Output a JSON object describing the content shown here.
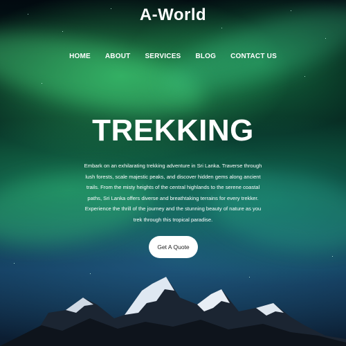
{
  "brand": {
    "logo": "A-World"
  },
  "nav": {
    "items": [
      {
        "label": "HOME"
      },
      {
        "label": "ABOUT"
      },
      {
        "label": "SERVICES"
      },
      {
        "label": "BLOG"
      },
      {
        "label": "CONTACT US"
      }
    ]
  },
  "hero": {
    "title": "TREKKING",
    "description": "Embark on an exhilarating trekking adventure in Sri Lanka. Traverse through lush forests, scale majestic peaks, and discover hidden gems along ancient trails. From the misty heights of the central highlands to the serene coastal paths, Sri Lanka offers diverse and breathtaking terrains for every trekker. Experience the thrill of the journey and the stunning beauty of nature as you trek through this tropical paradise.",
    "cta_label": "Get A Quote"
  },
  "colors": {
    "text": "#ffffff",
    "button_bg": "#ffffff",
    "button_text": "#222222",
    "aurora_green": "#3ce678",
    "night_sky": "#061a22"
  }
}
